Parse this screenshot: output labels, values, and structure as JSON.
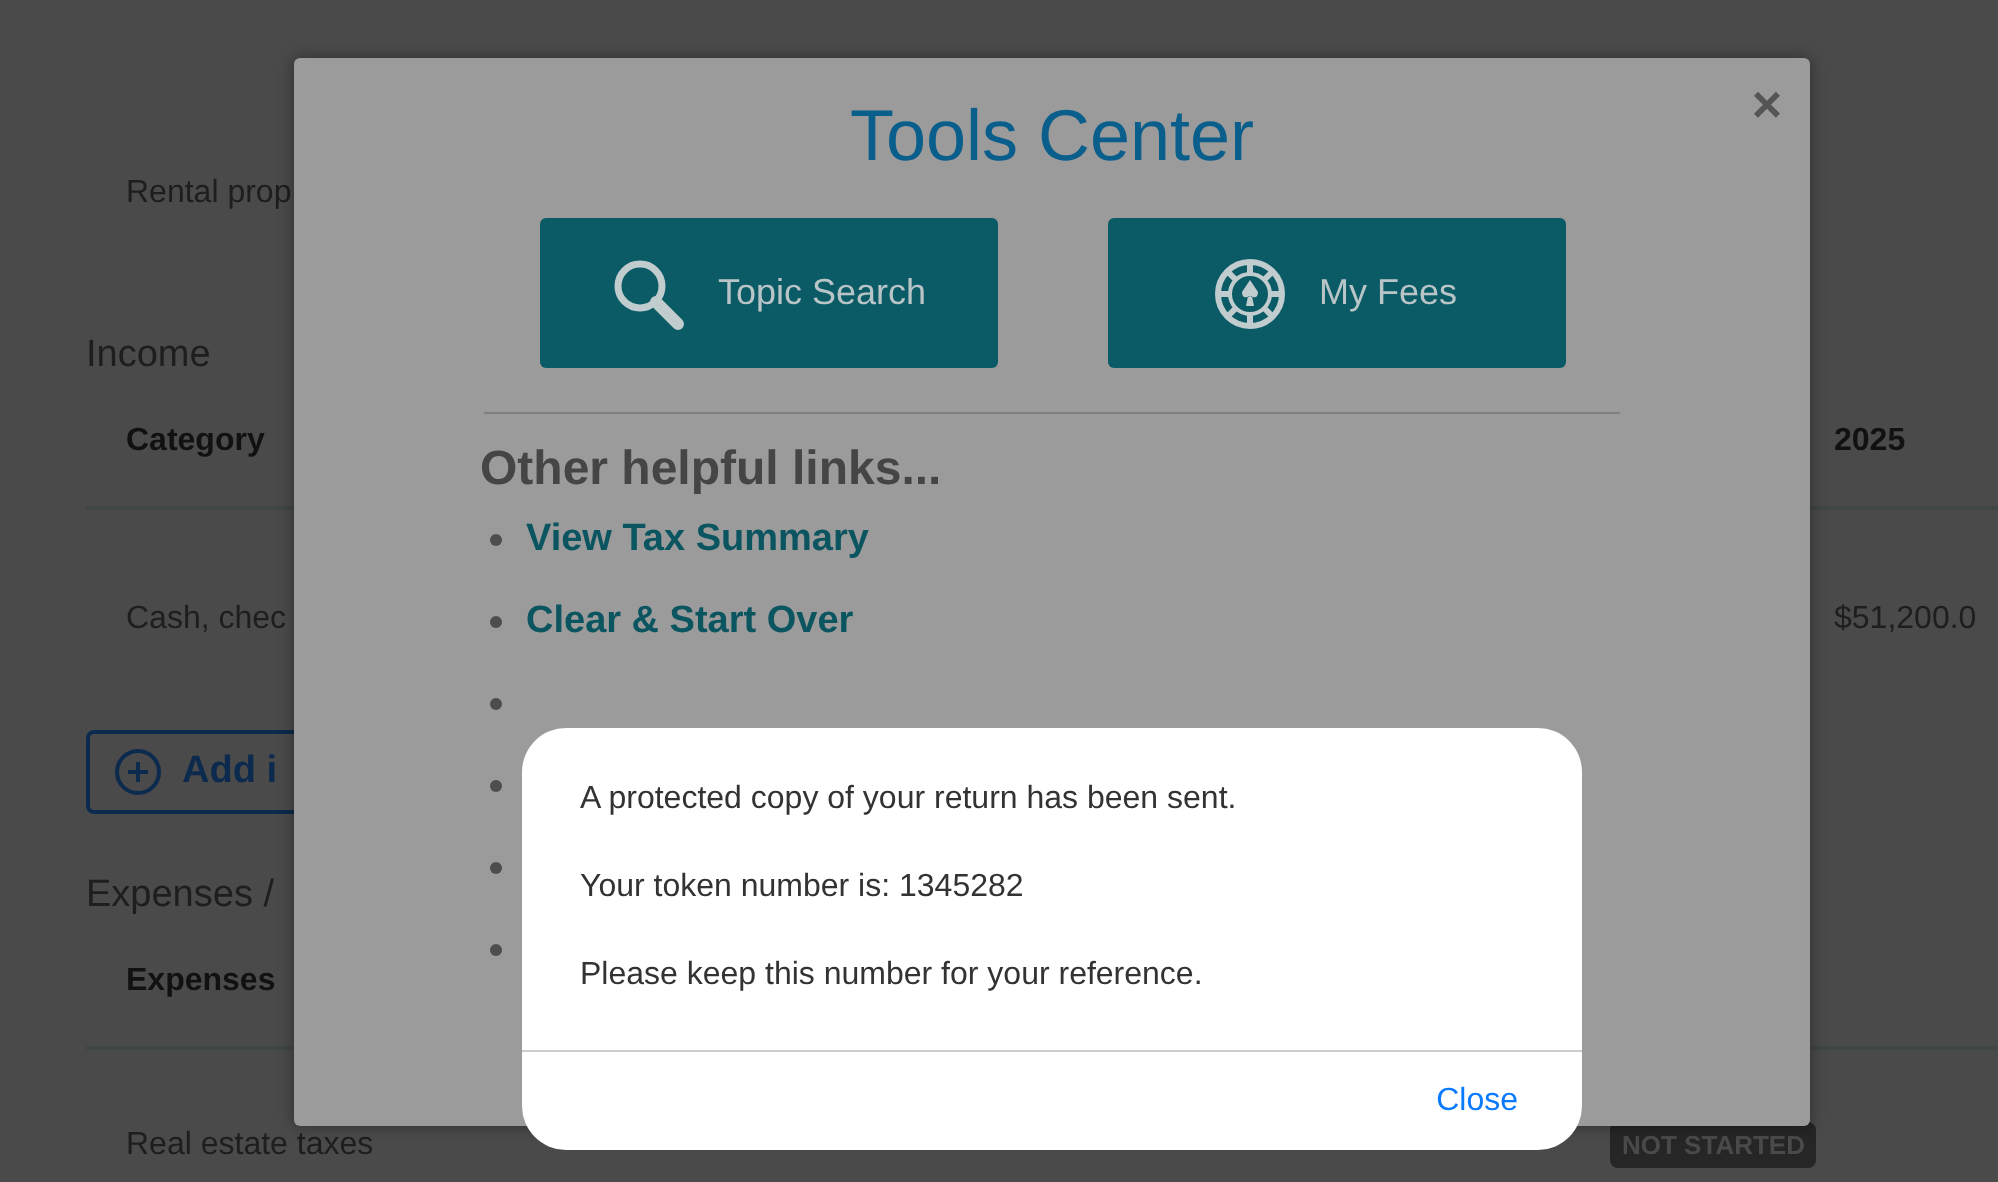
{
  "page": {
    "rental_label": "Rental prop",
    "income": {
      "heading": "Income",
      "columns": [
        "Category",
        "2025"
      ],
      "rows": [
        [
          "Cash, chec",
          "$51,200.0"
        ]
      ],
      "add_button": "Add i"
    },
    "expenses": {
      "heading": "Expenses / ",
      "columns": [
        "Expenses"
      ],
      "rows": [
        {
          "label": "Real estate taxes",
          "status": "NOT STARTED"
        }
      ]
    }
  },
  "tools_modal": {
    "title": "Tools Center",
    "close": "×",
    "buttons": [
      {
        "label": "Topic Search"
      },
      {
        "label": "My Fees"
      }
    ],
    "links_heading": "Other helpful links...",
    "links": [
      {
        "label": "View Tax Summary"
      },
      {
        "label": "Clear & Start Over"
      }
    ]
  },
  "alert": {
    "lines": [
      "A protected copy of your return has been sent.",
      "Your token number is: 1345282",
      "Please keep this number for your reference."
    ],
    "button": "Close"
  }
}
